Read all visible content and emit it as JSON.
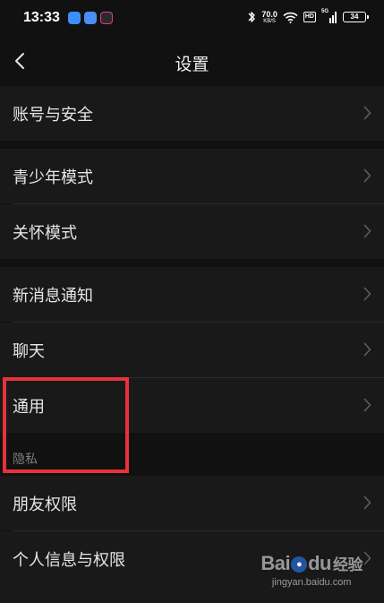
{
  "status_bar": {
    "time": "13:33",
    "net_speed": "70.0",
    "net_unit": "KB/S",
    "hd_label": "HD",
    "signal_label": "5G",
    "battery_level": "34"
  },
  "nav": {
    "title": "设置"
  },
  "settings": {
    "account_security": "账号与安全",
    "teen_mode": "青少年模式",
    "care_mode": "关怀模式",
    "new_message_notify": "新消息通知",
    "chat": "聊天",
    "general": "通用",
    "privacy_header": "隐私",
    "friend_permissions": "朋友权限",
    "personal_info_permissions": "个人信息与权限"
  },
  "watermark": {
    "brand": "Bai",
    "brand_suffix": "du",
    "cn": "经验",
    "url": "jingyan.baidu.com"
  },
  "colors": {
    "background": "#111111",
    "row": "#191919",
    "highlight": "#e8323a"
  }
}
